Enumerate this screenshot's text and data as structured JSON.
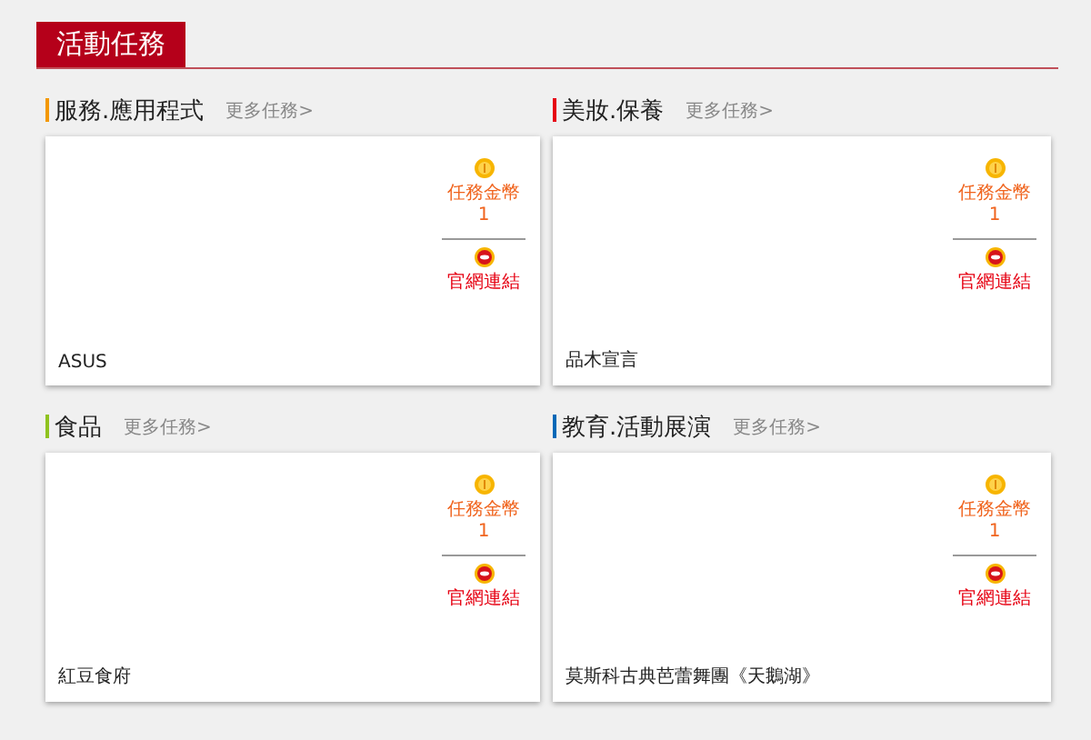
{
  "header": {
    "tab": "活動任務"
  },
  "sections": [
    {
      "title": "服務.應用程式",
      "color": "#f39800",
      "more": "更多任務>",
      "card": {
        "name": "ASUS",
        "reward_label": "任務金幣",
        "reward": "1",
        "link": "官網連結"
      }
    },
    {
      "title": "美妝.保養",
      "color": "#e60012",
      "more": "更多任務>",
      "card": {
        "name": "品木宣言",
        "reward_label": "任務金幣",
        "reward": "1",
        "link": "官網連結"
      }
    },
    {
      "title": "食品",
      "color": "#8fc31f",
      "more": "更多任務>",
      "card": {
        "name": "紅豆食府",
        "reward_label": "任務金幣",
        "reward": "1",
        "link": "官網連結"
      }
    },
    {
      "title": "教育.活動展演",
      "color": "#0068b7",
      "more": "更多任務>",
      "card": {
        "name": "莫斯科古典芭蕾舞團《天鵝湖》",
        "reward_label": "任務金幣",
        "reward": "1",
        "link": "官網連結"
      }
    }
  ]
}
